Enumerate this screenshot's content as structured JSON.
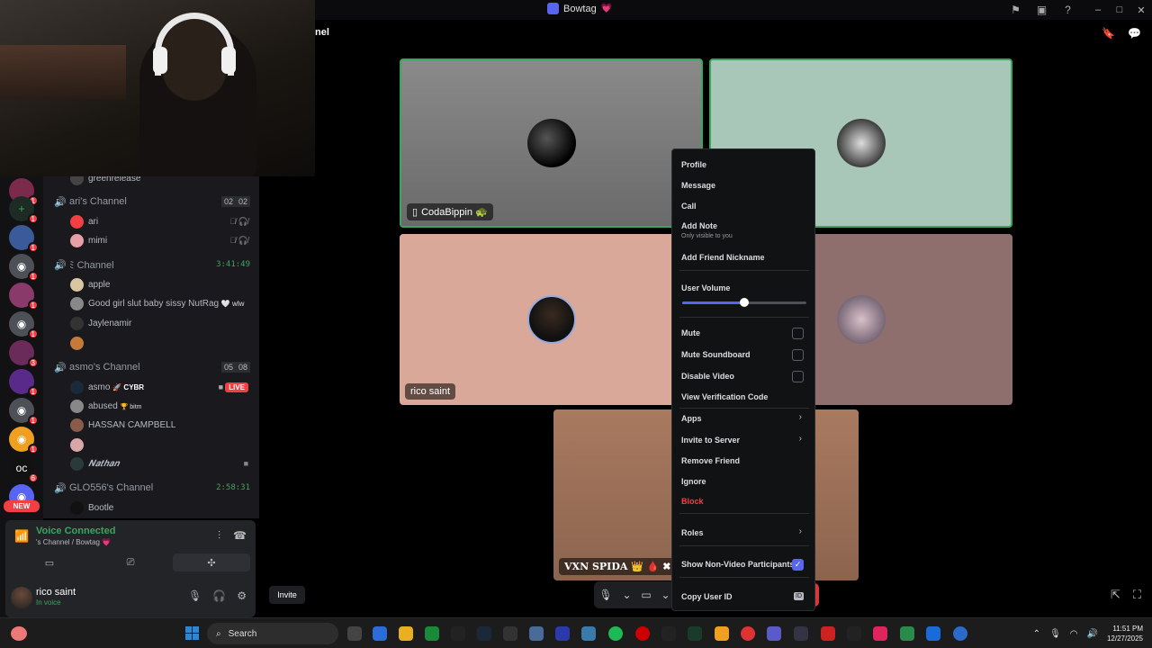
{
  "window": {
    "title": "Bowtag",
    "title_emoji": "💗",
    "channel_label": "nel"
  },
  "server_rail": {
    "badges": [
      "1",
      "1",
      "1",
      "1",
      "1",
      "1",
      "3",
      "1",
      "1",
      "1",
      "6",
      "NEW"
    ]
  },
  "channels": {
    "top_partial": "greenrelease",
    "voice": [
      {
        "name": "ari's Channel",
        "count_a": "02",
        "count_b": "02",
        "users": [
          {
            "name": "ari",
            "color": "#f23f43"
          },
          {
            "name": "mimi",
            "color": "#e8a0a8"
          }
        ]
      },
      {
        "name": "Channel",
        "prefix": "ﾐ",
        "time": "3:41:49",
        "users": [
          {
            "name": "apple",
            "color": "#d8c7a0"
          },
          {
            "name": "Good girl slut baby sissy NutRag",
            "extra": "🤍 wlw",
            "color": "#888"
          },
          {
            "name": "Jaylenamir",
            "color": "#333"
          },
          {
            "name": "",
            "color": "#c57a3a"
          }
        ]
      },
      {
        "name": "asmo's Channel",
        "count_a": "05",
        "count_b": "08",
        "users": [
          {
            "name": "asmo",
            "extra": "🚀 CYBR",
            "live": "LIVE",
            "color": "#1a2a3a"
          },
          {
            "name": "abused",
            "extra": "🏆 bitm",
            "color": "#888"
          },
          {
            "name": "HASSAN CAMPBELL",
            "color": "#8a5a4a"
          },
          {
            "name": "",
            "color": "#d8a8a8"
          },
          {
            "name": "𝑵𝒂𝒕𝒉𝒂𝒏",
            "color": "#2a3a3a"
          }
        ]
      },
      {
        "name": "GLO556's Channel",
        "time": "2:58:31",
        "users": [
          {
            "name": "Bootle",
            "color": "#111"
          }
        ]
      }
    ]
  },
  "voice_panel": {
    "status": "Voice Connected",
    "subtitle": "'s Channel / Bowtag 💗"
  },
  "user_panel": {
    "name": "rico saint",
    "status": "In voice"
  },
  "stage": {
    "tiles": [
      {
        "label": "CodaBippin 🐢",
        "has_phone": true,
        "bg": "#7a7a7a"
      },
      {
        "label": "",
        "bg": "#a8c7b8"
      },
      {
        "label": "rico saint",
        "bg": "#d9a898"
      },
      {
        "label": "",
        "bg": "#8e6f6e"
      },
      {
        "label": "𝐕𝐗𝐍 𝐒𝐏𝐈𝐃𝐀 👑 🩸 ✖",
        "bg": "#a87a60"
      }
    ],
    "invite_label": "Invite"
  },
  "context_menu": {
    "items": {
      "profile": "Profile",
      "message": "Message",
      "call": "Call",
      "add_note": "Add Note",
      "add_note_sub": "Only visible to you",
      "add_friend_nickname": "Add Friend Nickname",
      "user_volume": "User Volume",
      "mute": "Mute",
      "mute_soundboard": "Mute Soundboard",
      "disable_video": "Disable Video",
      "view_verification_code": "View Verification Code",
      "apps": "Apps",
      "invite_to_server": "Invite to Server",
      "remove_friend": "Remove Friend",
      "ignore": "Ignore",
      "block": "Block",
      "roles": "Roles",
      "show_non_video": "Show Non-Video Participants",
      "copy_user_id": "Copy User ID",
      "id_badge": "ID"
    },
    "user_volume_level": 0.5,
    "show_non_video_checked": true
  },
  "taskbar": {
    "search_placeholder": "Search",
    "time": "11:51 PM",
    "date": "12/27/2025"
  }
}
